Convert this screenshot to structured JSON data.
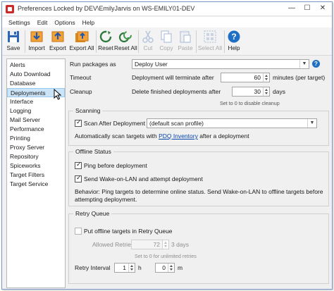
{
  "window": {
    "title": "Preferences Locked by DEV\\EmilyJarvis on WS-EMILY01-DEV",
    "minimize": "—",
    "maximize": "☐",
    "close": "✕"
  },
  "menu": [
    "Settings",
    "Edit",
    "Options",
    "Help"
  ],
  "toolbar": {
    "save": "Save",
    "import": "Import",
    "export": "Export",
    "export_all": "Export All",
    "reset": "Reset",
    "reset_all": "Reset All",
    "cut": "Cut",
    "copy": "Copy",
    "paste": "Paste",
    "select_all": "Select All",
    "help": "Help"
  },
  "nav": {
    "selected": "Deployments",
    "items": [
      "Alerts",
      "Auto Download",
      "Database",
      "Deployments",
      "Interface",
      "Logging",
      "Mail Server",
      "Performance",
      "Printing",
      "Proxy Server",
      "Repository",
      "Spiceworks",
      "Target Filters",
      "Target Service"
    ]
  },
  "deployments": {
    "run_packages_label": "Run packages as",
    "run_packages_value": "Deploy User",
    "timeout_label": "Timeout",
    "timeout_desc": "Deployment will terminate after",
    "timeout_value": "60",
    "timeout_unit": "minutes (per target)",
    "cleanup_label": "Cleanup",
    "cleanup_desc": "Delete finished deployments after",
    "cleanup_value": "30",
    "cleanup_unit": "days",
    "cleanup_hint": "Set to 0 to disable cleanup"
  },
  "scanning": {
    "title": "Scanning",
    "scan_after_label": "Scan After Deployment",
    "scan_after_checked": true,
    "scan_profile_value": "(default scan profile)",
    "desc_prefix": "Automatically scan targets with",
    "desc_link": "PDQ Inventory",
    "desc_suffix": "after a deployment"
  },
  "offline": {
    "title": "Offline Status",
    "ping_label": "Ping before deployment",
    "ping_checked": true,
    "wol_label": "Send Wake-on-LAN and attempt deployment",
    "wol_checked": true,
    "behavior_line1": "Behavior: Ping targets to determine online status. Send Wake-on-LAN to offline targets before",
    "behavior_line2": "attempting deployment."
  },
  "retry": {
    "title": "Retry Queue",
    "put_offline_label": "Put offline targets in Retry Queue",
    "put_offline_checked": false,
    "allowed_retries_label": "Allowed Retries",
    "allowed_retries_value": "72",
    "allowed_retries_unit": "3 days",
    "unlimited_hint": "Set to 0 for unlimited retries",
    "interval_label": "Retry Interval",
    "interval_hours": "1",
    "hours_unit": "h",
    "interval_minutes": "0",
    "minutes_unit": "m"
  },
  "icons": {
    "app": "pdq-app-icon",
    "save": "floppy-disk-icon",
    "import": "import-folder-icon",
    "export": "export-folder-icon",
    "export_all": "export-all-icon",
    "reset": "reset-arrows-icon",
    "reset_all": "reset-all-arrows-icon",
    "cut": "scissors-icon",
    "copy": "copy-icon",
    "paste": "paste-icon",
    "select_all": "select-all-icon",
    "help": "help-question-icon"
  },
  "colors": {
    "accent_blue": "#1f6fc5",
    "nav_selected": "#cce4f7",
    "link": "#0645ad"
  }
}
